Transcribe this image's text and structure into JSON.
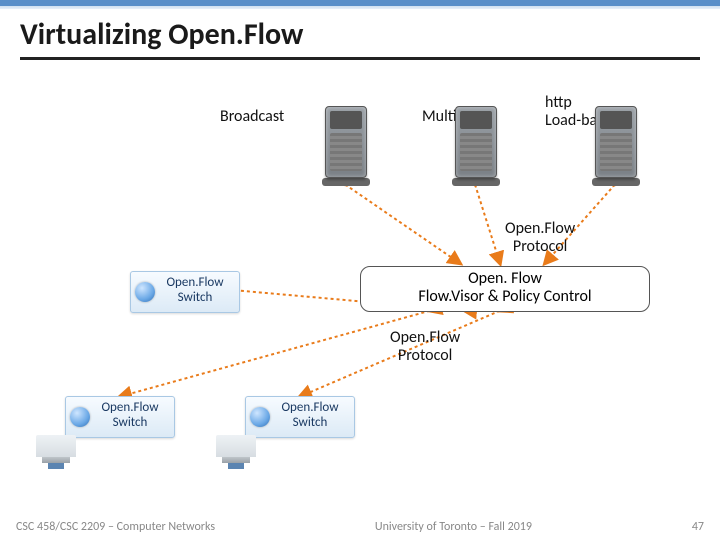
{
  "title": "Virtualizing Open.Flow",
  "labels": {
    "broadcast": "Broadcast",
    "multicast": "Multicast",
    "http_lb_1": "http",
    "http_lb_2": "Load-balancer",
    "proto_upper": "Open.Flow\nProtocol",
    "proto_lower": "Open.Flow\nProtocol"
  },
  "flowvisor": {
    "line1": "Open. Flow",
    "line2": "Flow.Visor & Policy Control"
  },
  "switches": {
    "mid": "Open.Flow Switch",
    "left": "Open.Flow Switch",
    "right": "Open.Flow Switch"
  },
  "footer": {
    "left": "CSC 458/CSC 2209 – Computer Networks",
    "center": "University of Toronto – Fall 2019",
    "right": "47"
  },
  "colors": {
    "dash_orange": "#e97b1a"
  }
}
